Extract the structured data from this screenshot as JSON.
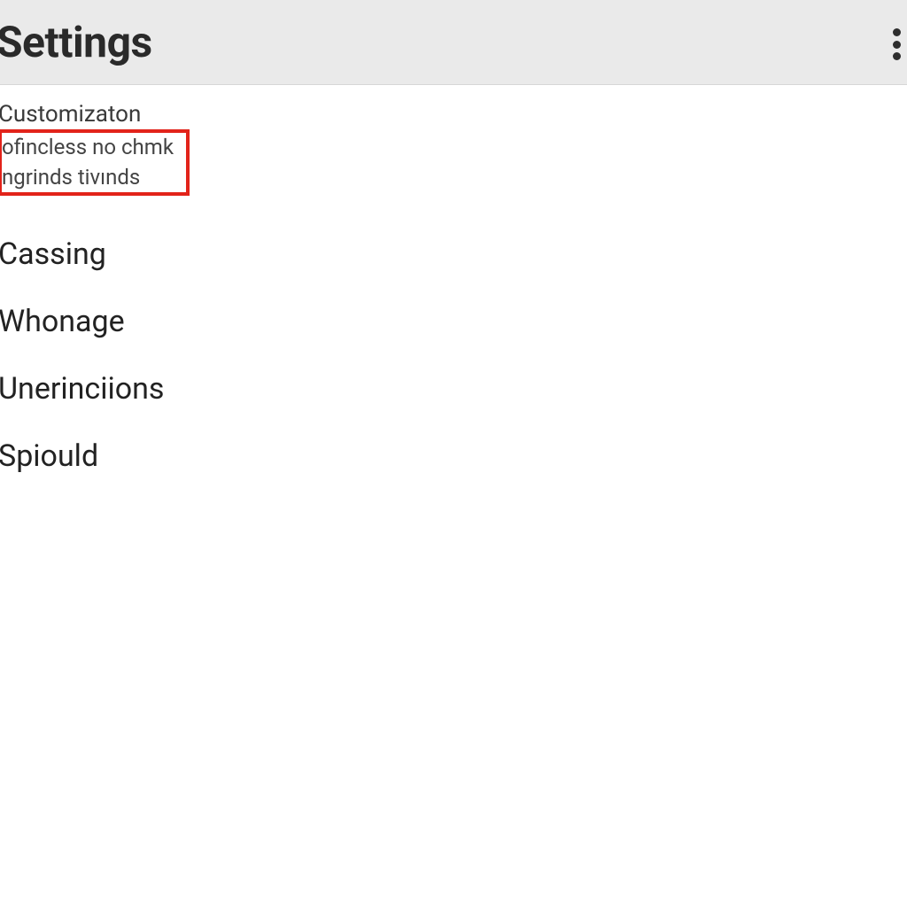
{
  "header": {
    "title": "Settings",
    "menu_icon": "more-vertical"
  },
  "customization": {
    "title": "Customizaton",
    "highlight_line1": "ofincless no chmk",
    "highlight_line2": "ngrinds tivınds"
  },
  "items": [
    {
      "label": "Cassing"
    },
    {
      "label": "Whonage"
    },
    {
      "label": "Unerinciions"
    },
    {
      "label": "Spiould"
    }
  ]
}
